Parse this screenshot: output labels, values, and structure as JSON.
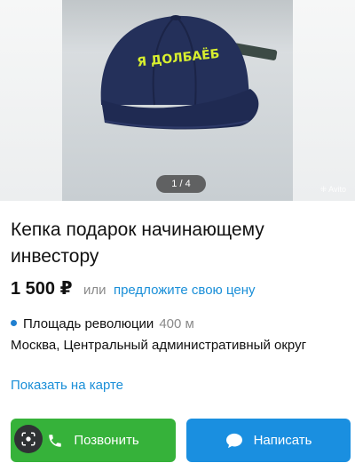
{
  "gallery": {
    "counter": "1 / 4",
    "watermark": "Avito",
    "cap_text": "Я ДОЛБАЁБ"
  },
  "listing": {
    "title": "Кепка подарок начинающему инвестору",
    "price": "1 500 ₽",
    "or_text": "или",
    "offer_link": "предложите свою цену",
    "metro": "Площадь революции",
    "metro_distance": "400 м",
    "address": "Москва, Центральный административный округ",
    "map_link": "Показать на карте"
  },
  "actions": {
    "call_label": "Позвонить",
    "message_label": "Написать"
  },
  "colors": {
    "call_button": "#36b23a",
    "message_button": "#1a8fe0",
    "link": "#1a8fd8",
    "metro_dot": "#1f7fd0"
  }
}
